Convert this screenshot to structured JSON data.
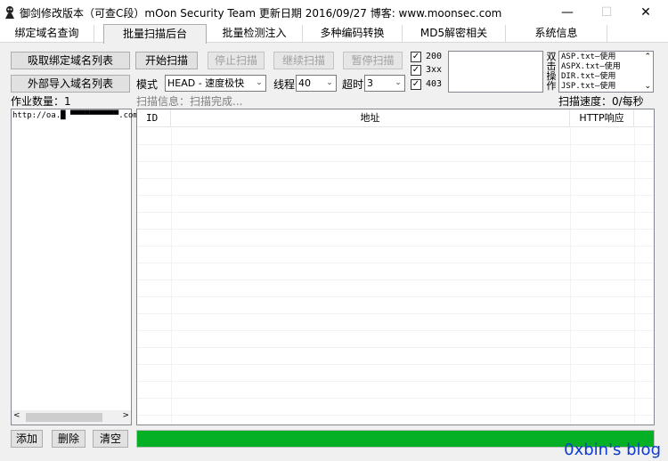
{
  "window": {
    "title": "御剑修改版本（可查C段）mOon Security Team 更新日期 2016/09/27 博客: www.moonsec.com",
    "minimize": "—",
    "maximize": "☐",
    "close": "✕"
  },
  "tabs": [
    {
      "label": "绑定域名查询"
    },
    {
      "label": "批量扫描后台"
    },
    {
      "label": "批量检测注入"
    },
    {
      "label": "多种编码转换"
    },
    {
      "label": "MD5解密相关"
    },
    {
      "label": "系统信息"
    }
  ],
  "left_panel": {
    "fetch_button": "吸取绑定域名列表",
    "import_button": "外部导入域名列表",
    "job_count_label": "作业数量：1",
    "job_items": [
      "http://oa.█  ▀▀▀▀▀▀▀▀▀▀.com"
    ],
    "add_button": "添加",
    "delete_button": "删除",
    "clear_button": "清空"
  },
  "toolbar": {
    "start_button": "开始扫描",
    "stop_button": "停止扫描",
    "continue_button": "继续扫描",
    "pause_button": "暂停扫描",
    "mode_label": "模式",
    "mode_value": "HEAD - 速度极快",
    "threads_label": "线程",
    "threads_value": "40",
    "timeout_label": "超时",
    "timeout_value": "3",
    "scan_info": "扫描信息：扫描完成...",
    "scan_speed": "扫描速度：0/每秒"
  },
  "status_filters": [
    {
      "label": "200",
      "checked": true
    },
    {
      "label": "3xx",
      "checked": true
    },
    {
      "label": "403",
      "checked": true
    }
  ],
  "dict_panel": {
    "side_label": [
      "双",
      "击",
      "操",
      "作"
    ],
    "items": [
      "ASP.txt—使用",
      "ASPX.txt—使用",
      "DIR.txt—使用",
      "JSP.txt—使用"
    ]
  },
  "results_table": {
    "columns": [
      "ID",
      "地址",
      "HTTP响应"
    ],
    "rows": []
  },
  "progress": {
    "value": 1.0
  },
  "colors": {
    "progress": "#06b025",
    "accent": "#0b3bd6"
  },
  "watermark": {
    "text": "0xbin's blog"
  }
}
